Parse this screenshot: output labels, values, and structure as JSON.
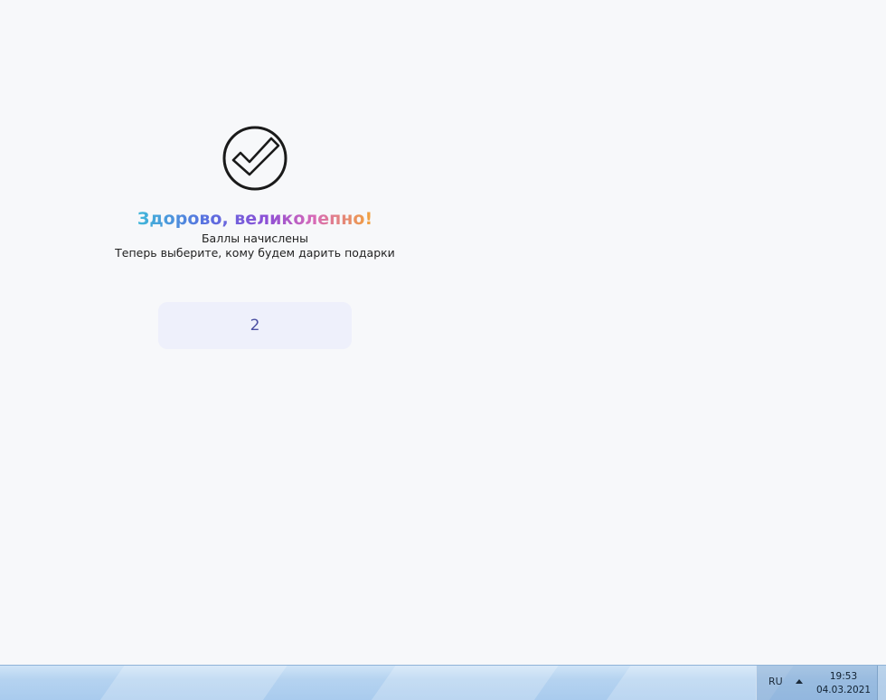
{
  "success": {
    "icon": "check-circle-icon",
    "headline": "Здорово, великолепно!",
    "line1": "Баллы начислены",
    "line2": "Теперь выберите, кому будем дарить подарки"
  },
  "choice": {
    "label": "2"
  },
  "taskbar": {
    "language": "RU",
    "tray_icon": "show-hidden-icons-arrow-icon",
    "time": "19:53",
    "date": "04.03.2021"
  },
  "colors": {
    "background": "#f7f8fa",
    "button_bg": "#eef0fb",
    "button_text": "#4b4fa2",
    "gradient": [
      "#3fb7d9",
      "#5a6fe0",
      "#8d4fd6",
      "#d76ab8",
      "#f2a33a"
    ]
  }
}
